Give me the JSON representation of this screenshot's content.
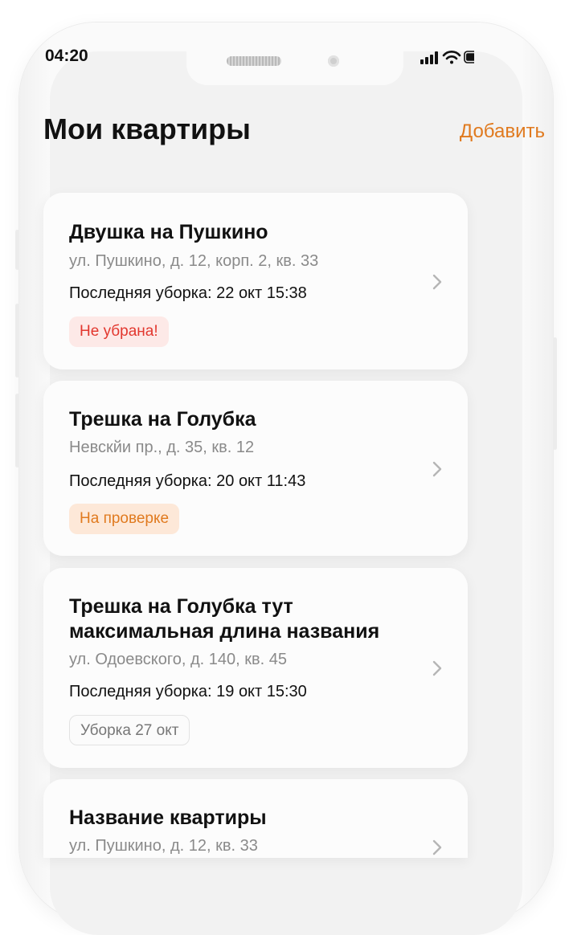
{
  "status": {
    "time": "04:20",
    "icons": [
      "signal-icon",
      "wifi-icon",
      "battery-icon"
    ]
  },
  "header": {
    "title": "Мои квартиры",
    "add_label": "Добавить"
  },
  "colors": {
    "accent": "#e07a1f",
    "danger": "#e2372e"
  },
  "apartments": [
    {
      "name": "Двушка на Пушкино",
      "address": "ул. Пушкино, д. 12, корп. 2, кв. 33",
      "last_cleaning": "Последняя уборка: 22 окт 15:38",
      "status": "Не убрана!",
      "status_style": "red"
    },
    {
      "name": "Трешка на Голубка",
      "address": "Невскйи пр., д. 35, кв. 12",
      "last_cleaning": "Последняя уборка: 20 окт 11:43",
      "status": "На проверке",
      "status_style": "orange"
    },
    {
      "name": "Трешка на Голубка тут максимальная длина названия",
      "address": "ул. Одоевского, д. 140, кв. 45",
      "last_cleaning": "Последняя уборка: 19 окт 15:30",
      "status": "Уборка 27 окт",
      "status_style": "gray"
    },
    {
      "name": "Название квартиры",
      "address": "ул. Пушкино, д. 12, кв. 33"
    }
  ]
}
